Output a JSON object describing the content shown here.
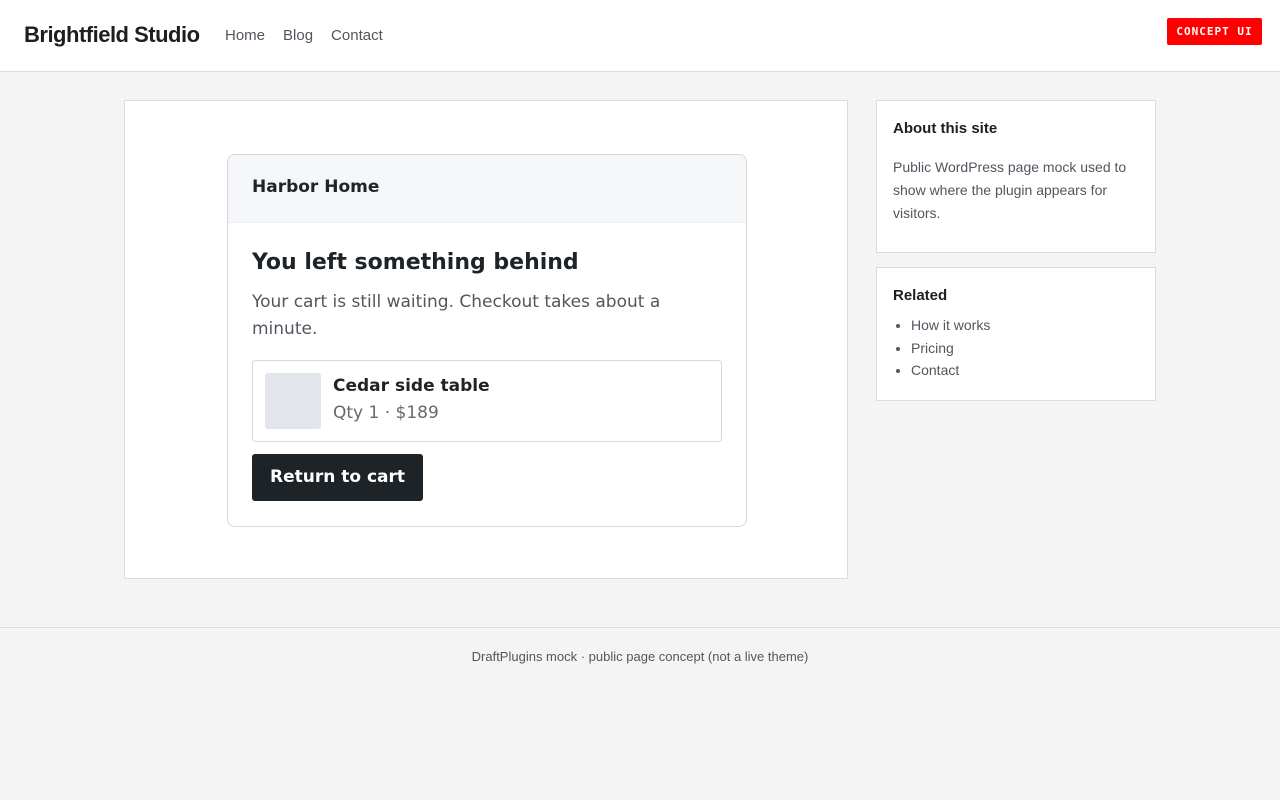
{
  "header": {
    "brand": "Brightfield Studio",
    "nav": [
      "Home",
      "Blog",
      "Contact"
    ],
    "badge": "CONCEPT UI"
  },
  "widget": {
    "store_name": "Harbor Home",
    "title": "You left something behind",
    "message": "Your cart is still waiting. Checkout takes about a minute.",
    "product": {
      "name": "Cedar side table",
      "meta": "Qty 1 · $189"
    },
    "cta_label": "Return to cart"
  },
  "sidebar": {
    "about": {
      "title": "About this site",
      "text": "Public WordPress page mock used to show where the plugin appears for visitors."
    },
    "related": {
      "title": "Related",
      "links": [
        "How it works",
        "Pricing",
        "Contact"
      ]
    }
  },
  "footer": {
    "text": "DraftPlugins mock · public page concept (not a live theme)"
  },
  "colors": {
    "badge": "#ff0000",
    "cta_background": "#1d2327",
    "thumb_placeholder": "#e2e6ec",
    "page_background": "#f4f4f4"
  }
}
